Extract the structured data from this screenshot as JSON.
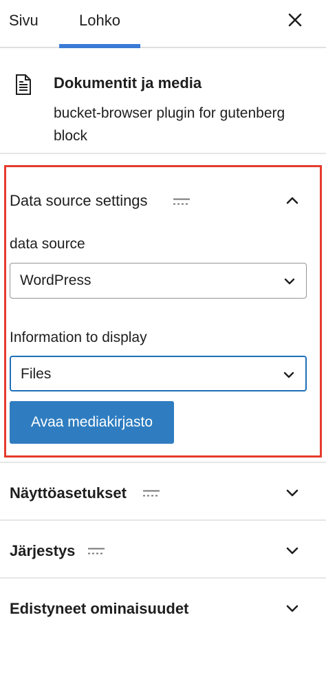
{
  "tabs": {
    "page": "Sivu",
    "block": "Lohko",
    "active": "Lohko"
  },
  "block": {
    "icon": "document-icon",
    "title": "Dokumentit ja media",
    "description": "bucket-browser plugin for gutenberg block"
  },
  "data_source_panel": {
    "title": "Data source settings",
    "expanded": true,
    "data_source": {
      "label": "data source",
      "value": "WordPress"
    },
    "info_display": {
      "label": "Information to display",
      "value": "Files"
    },
    "media_button": "Avaa mediakirjasto"
  },
  "panels": [
    {
      "title": "Näyttöasetukset",
      "expanded": false
    },
    {
      "title": "Järjestys",
      "expanded": false
    },
    {
      "title": "Edistyneet ominaisuudet",
      "expanded": false
    }
  ],
  "colors": {
    "accent": "#2f7dc0",
    "highlight": "#e53b2c",
    "tab_underline": "#3a7bd5"
  }
}
